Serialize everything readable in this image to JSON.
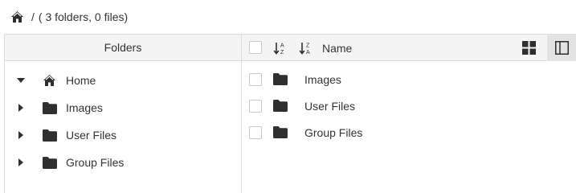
{
  "breadcrumb": {
    "separator": "/",
    "summary": "( 3 folders, 0 files)"
  },
  "folders_panel": {
    "title": "Folders",
    "items": [
      {
        "label": "Home",
        "expanded": true,
        "icon": "home-icon"
      },
      {
        "label": "Images",
        "expanded": false,
        "icon": "folder-icon"
      },
      {
        "label": "User Files",
        "expanded": false,
        "icon": "folder-icon"
      },
      {
        "label": "Group Files",
        "expanded": false,
        "icon": "folder-icon"
      }
    ]
  },
  "files_panel": {
    "name_header": "Name",
    "rows": [
      {
        "label": "Images"
      },
      {
        "label": "User Files"
      },
      {
        "label": "Group Files"
      }
    ]
  },
  "colors": {
    "icon": "#2f2f2f",
    "header_bg": "#f4f4f4",
    "border": "#dcdcdc",
    "active_view_bg": "#e3e3e3"
  }
}
